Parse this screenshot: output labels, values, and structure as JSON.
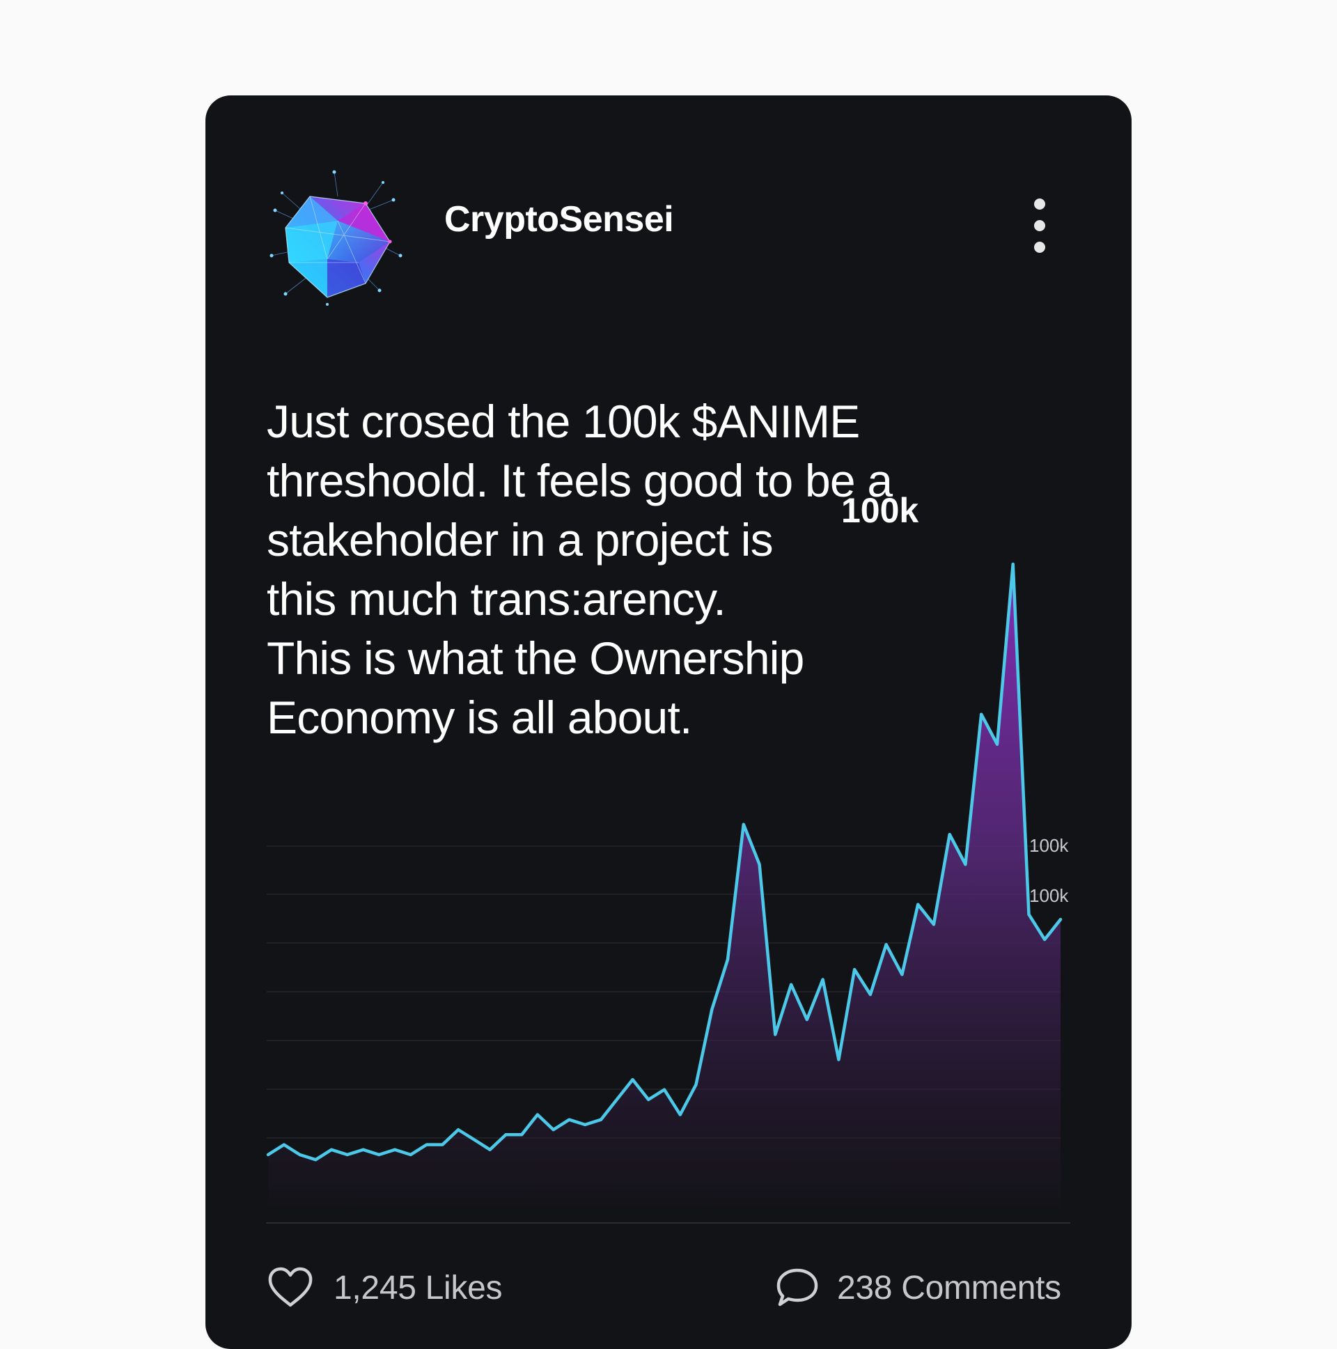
{
  "post": {
    "username": "CryptoSensei",
    "text_lines": [
      "Just crosed the 100k $ANIME",
      "threshoold. It feels good to be a",
      "stakeholder in a project is",
      "this much trans:arency.",
      "This is what the Ownership",
      "Economy is all about."
    ],
    "likes_label": "1,245 Likes",
    "comments_label": "238 Comments"
  },
  "icons": {
    "avatar": "polygon-crystal-logo",
    "more": "vertical-ellipsis-icon",
    "like": "heart-icon",
    "comment": "speech-bubble-icon"
  },
  "colors": {
    "card_bg": "#121316",
    "line": "#4cc9e8",
    "area_top": "#7a2fa8",
    "area_bottom": "#1c1622"
  },
  "chart_data": {
    "type": "area",
    "peak_label": "100k",
    "side_labels": [
      "100k",
      "100k"
    ],
    "grid": true,
    "values": [
      0,
      2,
      0,
      -1,
      1,
      0,
      1,
      0,
      1,
      0,
      2,
      2,
      5,
      3,
      1,
      4,
      4,
      8,
      5,
      7,
      6,
      7,
      11,
      15,
      11,
      13,
      8,
      14,
      29,
      39,
      66,
      58,
      24,
      34,
      27,
      35,
      19,
      37,
      32,
      42,
      36,
      50,
      46,
      64,
      58,
      88,
      82,
      118,
      48,
      43,
      47
    ]
  }
}
